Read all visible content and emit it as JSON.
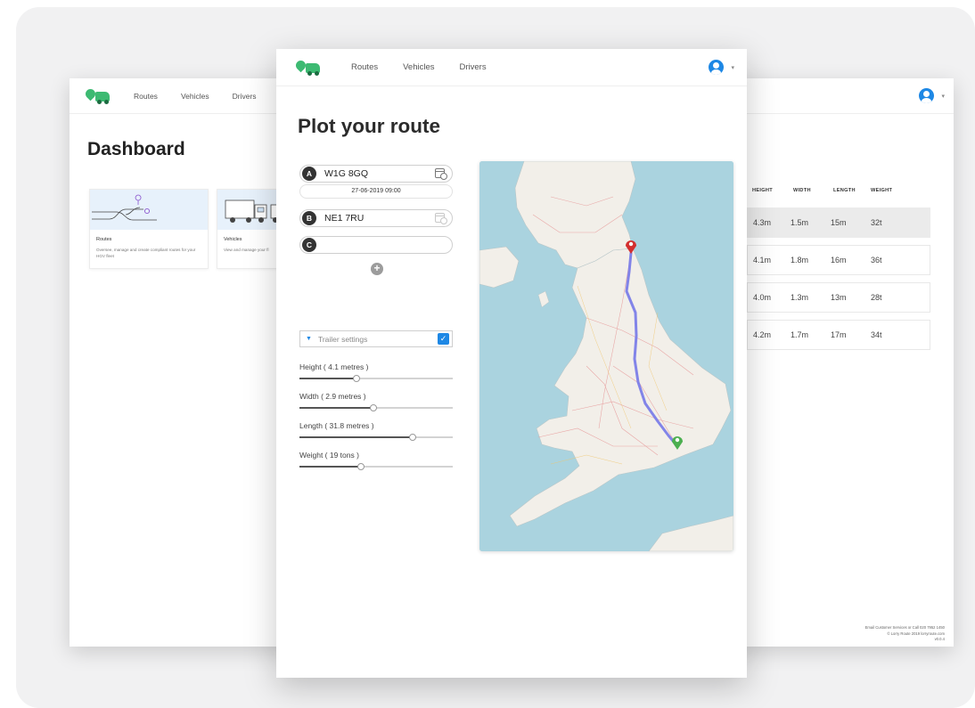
{
  "dashboard_window": {
    "nav": {
      "items": [
        "Routes",
        "Vehicles",
        "Drivers"
      ]
    },
    "title": "Dashboard",
    "cards": [
      {
        "title": "Routes",
        "description": "Oversee, manage and create compliant routes for your HGV fleet"
      },
      {
        "title": "Vehicles",
        "description": "View and manage your fl"
      }
    ]
  },
  "route_window": {
    "nav": {
      "items": [
        "Routes",
        "Vehicles",
        "Drivers"
      ]
    },
    "title": "Plot your route",
    "stops": [
      {
        "badge": "A",
        "value": "W1G 8GQ"
      },
      {
        "badge": "B",
        "value": "NE1 7RU"
      },
      {
        "badge": "C",
        "value": ""
      }
    ],
    "departure": "27-06-2019  09:00",
    "add_stop": "+",
    "trailer_settings_label": "Trailer settings",
    "trailer_settings_enabled": true,
    "sliders": [
      {
        "label": "Height ( 4.1 metres )",
        "level_pct": 37
      },
      {
        "label": "Width ( 2.9 metres )",
        "level_pct": 48
      },
      {
        "label": "Length ( 31.8 metres )",
        "level_pct": 74
      },
      {
        "label": "Weight ( 19 tons )",
        "level_pct": 40
      }
    ],
    "map": {
      "start_marker_color": "#4caf50",
      "end_marker_color": "#d32f2f",
      "route_color": "#7b7de8"
    }
  },
  "vehicles_window": {
    "columns": [
      "HEIGHT",
      "WIDTH",
      "LENGTH",
      "WEIGHT"
    ],
    "rows": [
      [
        "4.3m",
        "1.5m",
        "15m",
        "32t"
      ],
      [
        "4.1m",
        "1.8m",
        "16m",
        "36t"
      ],
      [
        "4.0m",
        "1.3m",
        "13m",
        "28t"
      ],
      [
        "4.2m",
        "1.7m",
        "17m",
        "34t"
      ]
    ],
    "footer": [
      "Email Customer Services or Call 020 7952 1450",
      "© Lorry Route 2019 lorryroute.com",
      "v0.0.4"
    ]
  },
  "colors": {
    "brand": "#3dba72",
    "accent": "#1e88e5"
  }
}
